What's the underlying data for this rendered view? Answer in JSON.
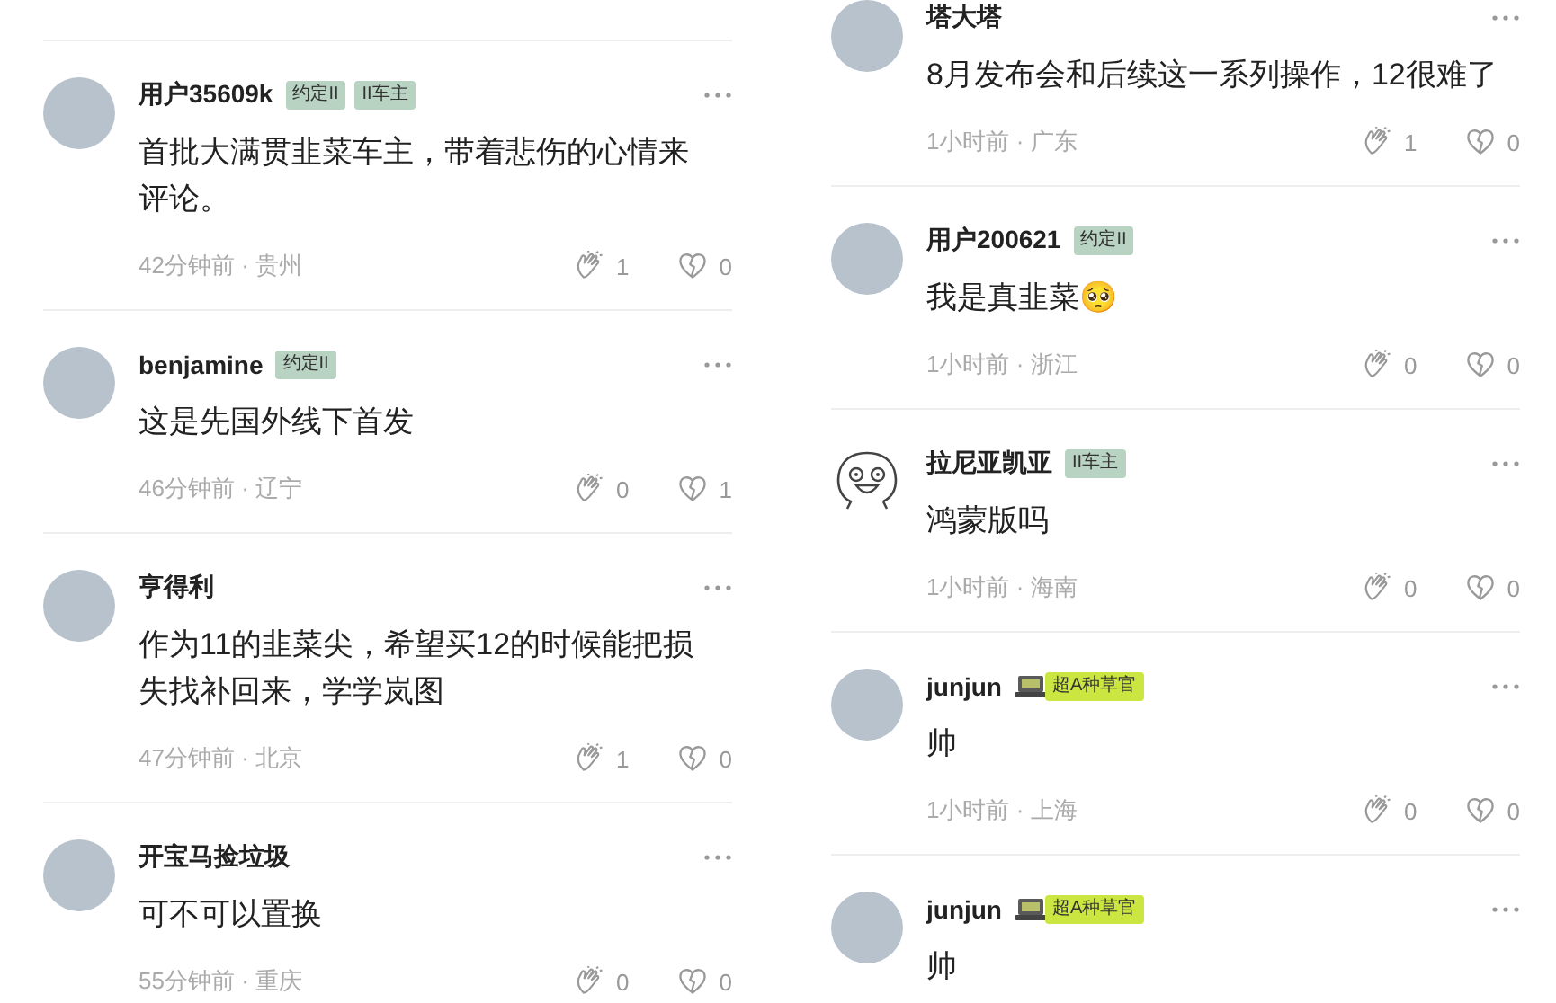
{
  "columns": [
    {
      "comments": [
        {
          "kind": "photo",
          "name": "用户35609k",
          "badges": [
            {
              "kind": "tag",
              "text": "约定II"
            },
            {
              "kind": "tag",
              "text": "II车主"
            }
          ],
          "body": "首批大满贯韭菜车主，带着悲伤的心情来评论。",
          "meta": "42分钟前 · 贵州",
          "likes": "1",
          "dislikes": "0"
        },
        {
          "kind": "photo",
          "name": "benjamine",
          "badges": [
            {
              "kind": "tag",
              "text": "约定II"
            }
          ],
          "body": "这是先国外线下首发",
          "meta": "46分钟前 · 辽宁",
          "likes": "0",
          "dislikes": "1"
        },
        {
          "kind": "photo",
          "name": "亨得利",
          "body": "作为11的韭菜尖，希望买12的时候能把损失找补回来，学学岚图",
          "meta": "47分钟前 · 北京",
          "likes": "1",
          "dislikes": "0"
        },
        {
          "kind": "photo",
          "name": "开宝马捡垃圾",
          "body": "可不可以置换",
          "meta": "55分钟前 · 重庆",
          "likes": "0",
          "dislikes": "0"
        }
      ]
    },
    {
      "comments": [
        {
          "kind": "photo",
          "name": "塔大塔",
          "body": "8月发布会和后续这一系列操作，12很难了",
          "meta": "1小时前 · 广东",
          "likes": "1",
          "dislikes": "0"
        },
        {
          "kind": "photo",
          "name": "用户200621",
          "badges": [
            {
              "kind": "tag",
              "text": "约定II"
            }
          ],
          "body": "我是真韭菜🥺",
          "meta": "1小时前 · 浙江",
          "likes": "0",
          "dislikes": "0"
        },
        {
          "kind": "cartoon",
          "name": "拉尼亚凯亚",
          "badges": [
            {
              "kind": "tag",
              "text": "II车主"
            }
          ],
          "body": "鸿蒙版吗",
          "meta": "1小时前 · 海南",
          "likes": "0",
          "dislikes": "0"
        },
        {
          "kind": "photo",
          "name": "junjun",
          "badges": [
            {
              "kind": "award",
              "text": "超A种草官"
            }
          ],
          "body": "帅",
          "meta": "1小时前 · 上海",
          "likes": "0",
          "dislikes": "0"
        },
        {
          "kind": "photo",
          "name": "junjun",
          "badges": [
            {
              "kind": "award",
              "text": "超A种草官"
            }
          ],
          "body": "帅"
        }
      ]
    }
  ]
}
